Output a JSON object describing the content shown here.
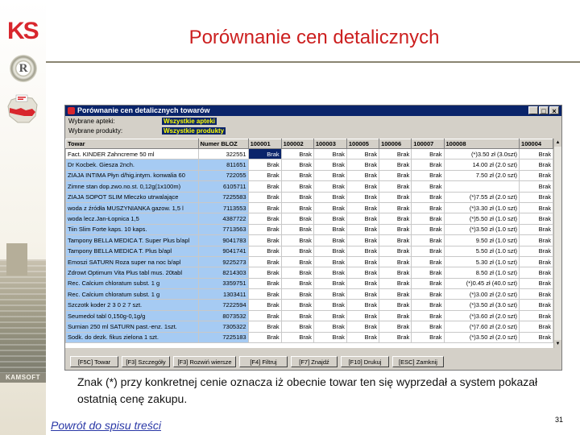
{
  "slide": {
    "title": "Porównanie cen detalicznych",
    "note_prefix": "Znak ",
    "note_marker": "(*)",
    "note_rest": " przy konkretnej cenie oznacza iż obecnie towar ten się wyprzedał a system pokazał ostatnią cenę zakupu.",
    "back_link": "Powrót do spisu treści",
    "page_number": "31",
    "sidebar_brand": "KAMSOFT",
    "logo_text": "KS",
    "seal_text": "R",
    "accent_color": "#cc1f1f"
  },
  "window": {
    "title": "Porównanie cen detalicznych towarów",
    "minimize_glyph": "_",
    "maximize_glyph": "□",
    "close_glyph": "×",
    "filters": [
      {
        "label": "Wybrane apteki:",
        "value": "Wszystkie apteki"
      },
      {
        "label": "Wybrane produkty:",
        "value": "Wszystkie produkty"
      }
    ],
    "columns": [
      "Towar",
      "Numer BLOZ",
      "100001",
      "100002",
      "100003",
      "100005",
      "100006",
      "100007",
      "100008",
      "100004"
    ],
    "rows": [
      [
        "Fact. KINDER Zahncreme 50 ml",
        "322551",
        "Brak",
        "Brak",
        "Brak",
        "Brak",
        "Brak",
        "Brak",
        "(*)3.50 zł (3.0szt)",
        "Brak"
      ],
      [
        "Dr Kocbek. Giesza 2nch.",
        "811651",
        "Brak",
        "Brak",
        "Brak",
        "Brak",
        "Brak",
        "Brak",
        "14.00 zł (2.0 szt)",
        "Brak"
      ],
      [
        "ZIAJA INTIMA Płyn d/hig.intym. konwalia 60",
        "722055",
        "Brak",
        "Brak",
        "Brak",
        "Brak",
        "Brak",
        "Brak",
        "7.50 zł (2.0 szt)",
        "Brak"
      ],
      [
        "Zimne stan dop.zwo.no.st. 0,12g(1x100m)",
        "6105711",
        "Brak",
        "Brak",
        "Brak",
        "Brak",
        "Brak",
        "Brak",
        "",
        "Brak"
      ],
      [
        "ZIAJA SOPOT SLIM Mleczko utrwalające",
        "7225583",
        "Brak",
        "Brak",
        "Brak",
        "Brak",
        "Brak",
        "Brak",
        "(*)7.55 zł (2.0 szt)",
        "Brak"
      ],
      [
        "woda z źródła MUSZYNIANKA gazow. 1,5 l",
        "7113553",
        "Brak",
        "Brak",
        "Brak",
        "Brak",
        "Brak",
        "Brak",
        "(*)3.30 zł (1.0 szt)",
        "Brak"
      ],
      [
        "woda lecz.Jan-Łopnica 1,5",
        "4387722",
        "Brak",
        "Brak",
        "Brak",
        "Brak",
        "Brak",
        "Brak",
        "(*)5.50 zł (1.0 szt)",
        "Brak"
      ],
      [
        "Tiin Slim Forte kaps. 10 kaps.",
        "7713563",
        "Brak",
        "Brak",
        "Brak",
        "Brak",
        "Brak",
        "Brak",
        "(*)3.50 zł (1.0 szt)",
        "Brak"
      ],
      [
        "Tampony BELLA MEDICA T. Super Plus b/apl",
        "9041783",
        "Brak",
        "Brak",
        "Brak",
        "Brak",
        "Brak",
        "Brak",
        "9.50 zł (1.0 szt)",
        "Brak"
      ],
      [
        "Tampony BELLA MEDICA T. Plus b/apl",
        "9041741",
        "Brak",
        "Brak",
        "Brak",
        "Brak",
        "Brak",
        "Brak",
        "5.50 zł (1.0 szt)",
        "Brak"
      ],
      [
        "Emoszi SATURN Roza super na noc b/apl",
        "9225273",
        "Brak",
        "Brak",
        "Brak",
        "Brak",
        "Brak",
        "Brak",
        "5.30 zł (1.0 szt)",
        "Brak"
      ],
      [
        "Zdrowt Optimum Vita Plus tabl mus. 20tabl",
        "8214303",
        "Brak",
        "Brak",
        "Brak",
        "Brak",
        "Brak",
        "Brak",
        "8.50 zł (1.0 szt)",
        "Brak"
      ],
      [
        "Rec. Calcium chloratum subst. 1 g",
        "3359751",
        "Brak",
        "Brak",
        "Brak",
        "Brak",
        "Brak",
        "Brak",
        "(*)0.45 zł (40.0 szt)",
        "Brak"
      ],
      [
        "Rec. Calcium chloratum subst. 1 g",
        "1303411",
        "Brak",
        "Brak",
        "Brak",
        "Brak",
        "Brak",
        "Brak",
        "(*)3.00 zł (2.0 szt)",
        "Brak"
      ],
      [
        "Szczotk koder 2 3 0 2 7 szt.",
        "7222594",
        "Brak",
        "Brak",
        "Brak",
        "Brak",
        "Brak",
        "Brak",
        "(*)3.50 zł (3.0 szt)",
        "Brak"
      ],
      [
        "Seumedol tabl 0,150g-0,1g/g",
        "8073532",
        "Brak",
        "Brak",
        "Brak",
        "Brak",
        "Brak",
        "Brak",
        "(*)3.60 zł (2.0 szt)",
        "Brak"
      ],
      [
        "Surnian 250 ml SATURN past.-enz. 1szt.",
        "7305322",
        "Brak",
        "Brak",
        "Brak",
        "Brak",
        "Brak",
        "Brak",
        "(*)7.60 zł (2.0 szt)",
        "Brak"
      ],
      [
        "Sodk. do dezk. fikus zielona 1 szt.",
        "7225183",
        "Brak",
        "Brak",
        "Brak",
        "Brak",
        "Brak",
        "Brak",
        "(*)3.50 zł (2.0 szt)",
        "Brak"
      ]
    ],
    "function_keys": [
      "[F5C] Towar",
      "[F3] Szczegóły",
      "[F3] Rozwiń wiersze",
      "[F4] Filtruj",
      "[F7] Znajdź",
      "[F10] Drukuj",
      "[ESC] Zamknij"
    ]
  }
}
